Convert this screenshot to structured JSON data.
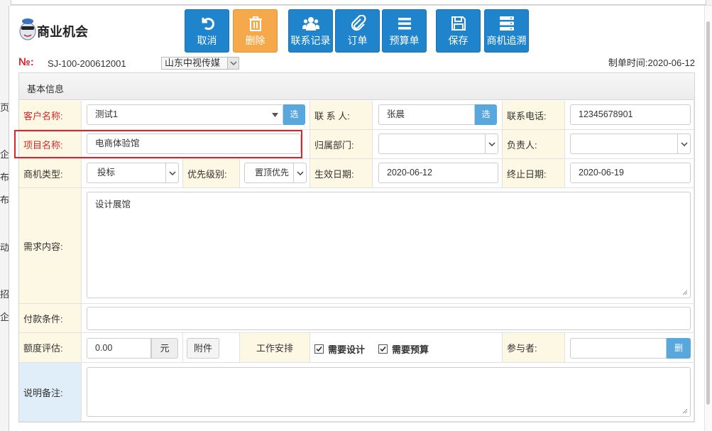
{
  "background_fragments": [
    "页",
    "企",
    "布",
    "布",
    "动",
    "招",
    "企"
  ],
  "header": {
    "title": "商业机会",
    "toolbar": [
      {
        "id": "cancel",
        "label": "取消",
        "icon": "undo-icon"
      },
      {
        "id": "delete",
        "label": "删除",
        "icon": "trash-icon"
      },
      {
        "id": "contacts",
        "label": "联系记录",
        "icon": "users-icon"
      },
      {
        "id": "orders",
        "label": "订单",
        "icon": "paperclip-icon"
      },
      {
        "id": "budget",
        "label": "预算单",
        "icon": "menu-icon"
      },
      {
        "id": "save",
        "label": "保存",
        "icon": "save-icon"
      },
      {
        "id": "trace",
        "label": "商机追溯",
        "icon": "server-icon"
      }
    ],
    "no_label": "№:",
    "no_value": "SJ-100-200612001",
    "company": "山东中视传媒",
    "created_label": "制单时间:",
    "created_value": "2020-06-12"
  },
  "panel_title": "基本信息",
  "form": {
    "customer_label": "客户名称:",
    "customer_value": "测试1",
    "pick_label": "选",
    "contact_label": "联 系 人:",
    "contact_value": "张晨",
    "phone_label": "联系电话:",
    "phone_value": "12345678901",
    "project_label": "项目名称:",
    "project_value": "电商体验馆",
    "dept_label": "归属部门:",
    "dept_value": "",
    "owner_label": "负责人:",
    "owner_value": "",
    "type_label": "商机类型:",
    "type_value": "投标",
    "priority_label": "优先级别:",
    "priority_value": "置顶优先",
    "start_label": "生效日期:",
    "start_value": "2020-06-12",
    "end_label": "终止日期:",
    "end_value": "2020-06-19",
    "demand_label": "需求内容:",
    "demand_value": "设计展馆",
    "payment_label": "付款条件:",
    "payment_value": "",
    "amount_label": "额度评估:",
    "amount_value": "0.00",
    "amount_unit": "元",
    "attachment_label": "附件",
    "work_label": "工作安排",
    "need_design_label": "需要设计",
    "need_design_checked": true,
    "need_budget_label": "需要预算",
    "need_budget_checked": true,
    "participants_label": "参与者:",
    "participants_value": "",
    "remove_label": "删",
    "remark_label": "说明备注:",
    "remark_value": ""
  },
  "colors": {
    "toolbar_blue": "#1f84cc",
    "toolbar_orange": "#f5a94a",
    "label_bg": "#fdf8e3",
    "required_red": "#d9262b",
    "pick_blue": "#58a8dd"
  }
}
